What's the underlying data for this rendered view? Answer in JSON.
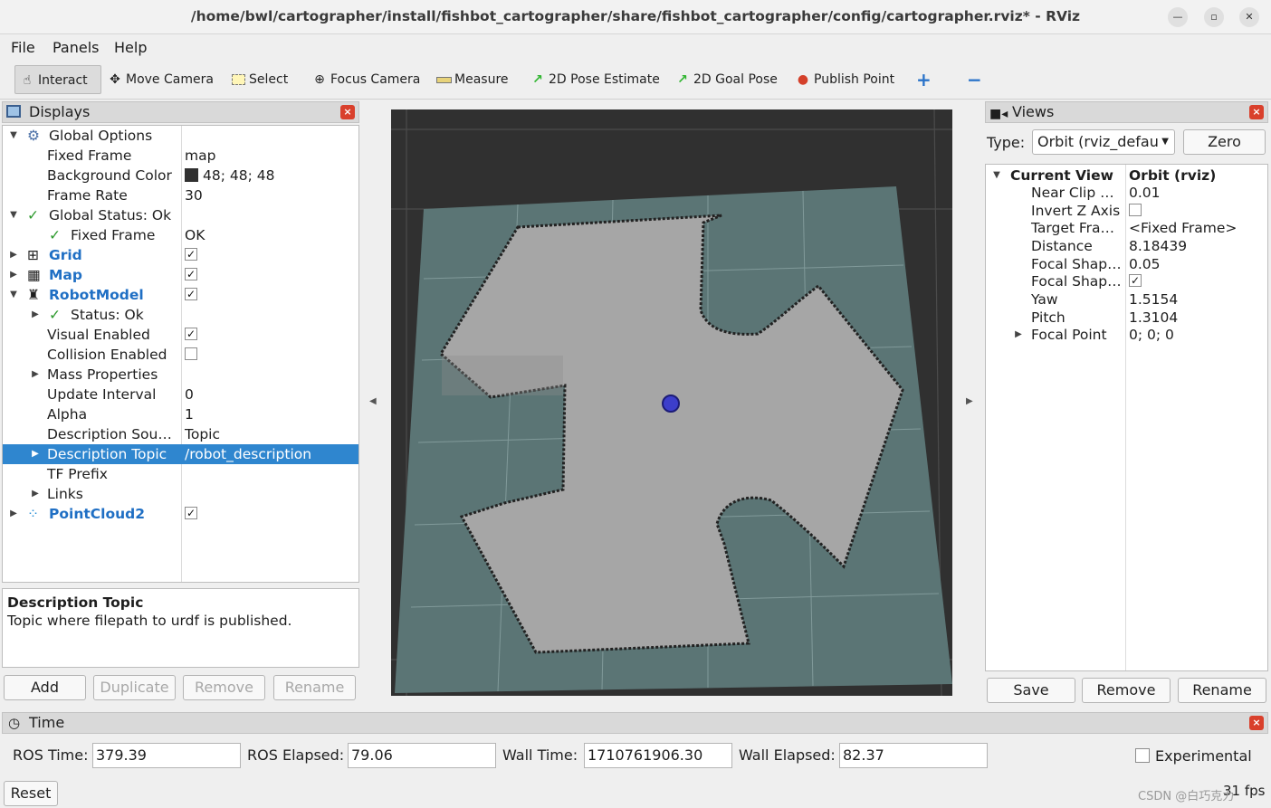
{
  "window": {
    "title": "/home/bwl/cartographer/install/fishbot_cartographer/share/fishbot_cartographer/config/cartographer.rviz* - RViz"
  },
  "menu": {
    "file": "File",
    "panels": "Panels",
    "help": "Help"
  },
  "toolbar": {
    "interact": "Interact",
    "move_camera": "Move Camera",
    "select": "Select",
    "focus_camera": "Focus Camera",
    "measure": "Measure",
    "pose_estimate": "2D Pose Estimate",
    "goal_pose": "2D Goal Pose",
    "publish_point": "Publish Point"
  },
  "displays": {
    "title": "Displays",
    "rows": [
      {
        "label": "Global Options",
        "value": ""
      },
      {
        "label": "Fixed Frame",
        "value": "map"
      },
      {
        "label": "Background Color",
        "value": "48; 48; 48"
      },
      {
        "label": "Frame Rate",
        "value": "30"
      },
      {
        "label": "Global Status: Ok",
        "value": ""
      },
      {
        "label": "Fixed Frame",
        "value": "OK"
      },
      {
        "label": "Grid",
        "value": ""
      },
      {
        "label": "Map",
        "value": ""
      },
      {
        "label": "RobotModel",
        "value": ""
      },
      {
        "label": "Status: Ok",
        "value": ""
      },
      {
        "label": "Visual Enabled",
        "value": ""
      },
      {
        "label": "Collision Enabled",
        "value": ""
      },
      {
        "label": "Mass Properties",
        "value": ""
      },
      {
        "label": "Update Interval",
        "value": "0"
      },
      {
        "label": "Alpha",
        "value": "1"
      },
      {
        "label": "Description Sou…",
        "value": "Topic"
      },
      {
        "label": "Description Topic",
        "value": "/robot_description"
      },
      {
        "label": "TF Prefix",
        "value": ""
      },
      {
        "label": "Links",
        "value": ""
      },
      {
        "label": "PointCloud2",
        "value": ""
      }
    ],
    "desc_title": "Description Topic",
    "desc_text": "Topic where filepath to urdf is published.",
    "buttons": {
      "add": "Add",
      "duplicate": "Duplicate",
      "remove": "Remove",
      "rename": "Rename"
    }
  },
  "views": {
    "title": "Views",
    "type_label": "Type:",
    "type_value": "Orbit (rviz_defau",
    "zero": "Zero",
    "header_label": "Current View",
    "header_value": "Orbit (rviz)",
    "rows": [
      {
        "label": "Near Clip …",
        "value": "0.01"
      },
      {
        "label": "Invert Z Axis",
        "value": ""
      },
      {
        "label": "Target Fra…",
        "value": "<Fixed Frame>"
      },
      {
        "label": "Distance",
        "value": "8.18439"
      },
      {
        "label": "Focal Shap…",
        "value": "0.05"
      },
      {
        "label": "Focal Shap…",
        "value": ""
      },
      {
        "label": "Yaw",
        "value": "1.5154"
      },
      {
        "label": "Pitch",
        "value": "1.3104"
      },
      {
        "label": "Focal Point",
        "value": "0; 0; 0"
      }
    ],
    "buttons": {
      "save": "Save",
      "remove": "Remove",
      "rename": "Rename"
    }
  },
  "time": {
    "title": "Time",
    "ros_time_label": "ROS Time:",
    "ros_time": "379.39",
    "ros_elapsed_label": "ROS Elapsed:",
    "ros_elapsed": "79.06",
    "wall_time_label": "Wall Time:",
    "wall_time": "1710761906.30",
    "wall_elapsed_label": "Wall Elapsed:",
    "wall_elapsed": "82.37",
    "experimental": "Experimental",
    "reset": "Reset",
    "fps": "31 fps",
    "watermark": "CSDN @白巧克力"
  },
  "colors": {
    "selection": "#2f86cf",
    "background": "#303030",
    "link_blue": "#1f6fc4",
    "status_ok": "#2e9a2e"
  }
}
